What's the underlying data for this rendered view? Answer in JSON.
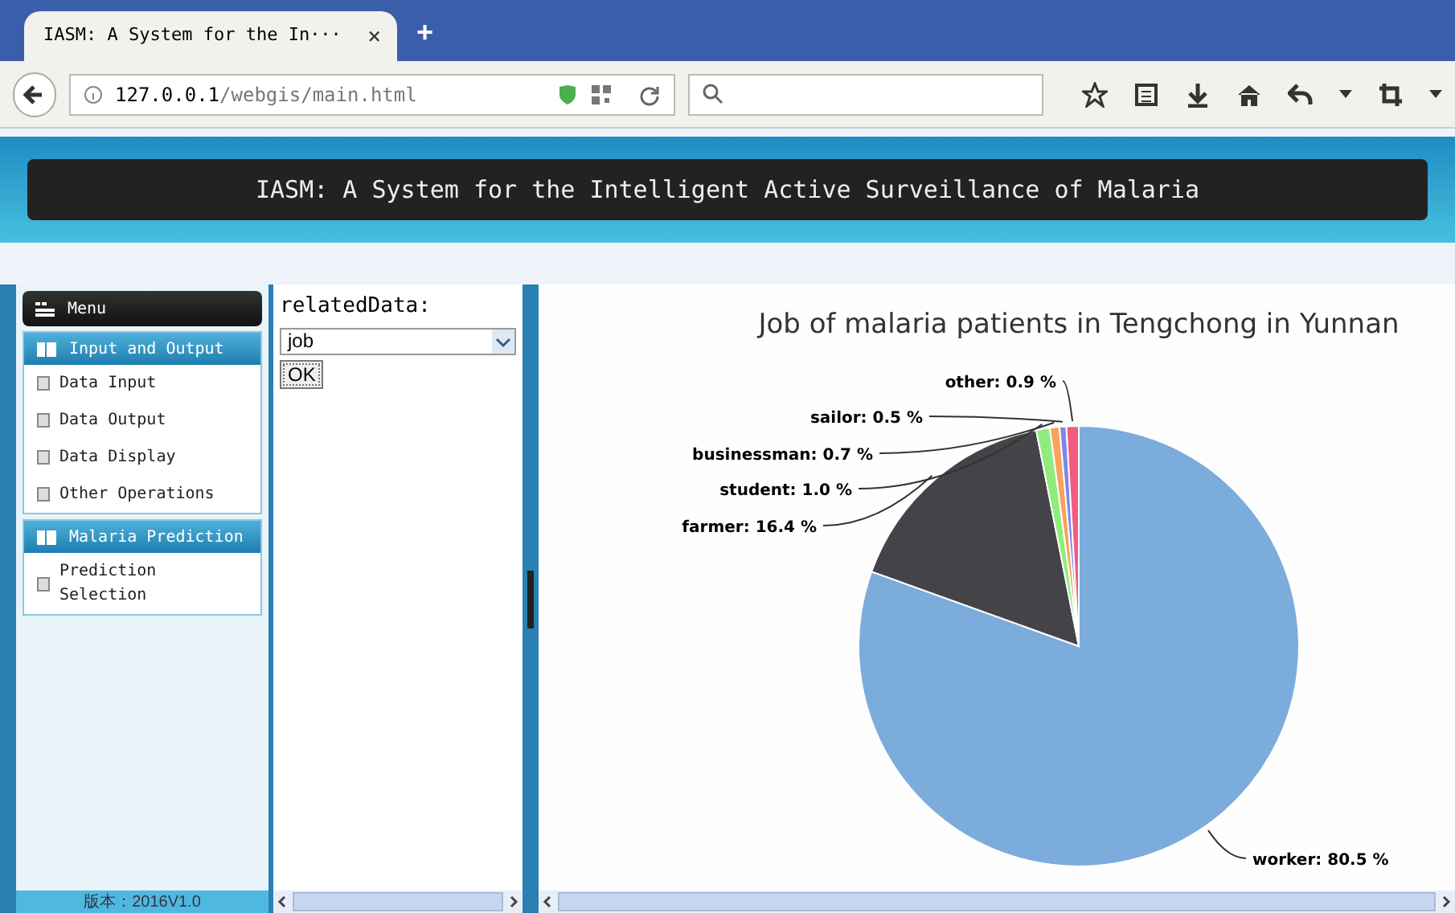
{
  "browser": {
    "tab_title": "IASM: A System for the In···",
    "tab_close": "×",
    "new_tab": "+",
    "url_host": "127.0.0.1",
    "url_path": "/webgis/main.html"
  },
  "banner": {
    "title": "IASM: A System for the Intelligent Active Surveillance of Malaria"
  },
  "sidebar": {
    "title": "Menu",
    "groups": [
      {
        "label": "Input and Output",
        "items": [
          {
            "label": "Data Input"
          },
          {
            "label": "Data Output"
          },
          {
            "label": "Data Display"
          },
          {
            "label": "Other Operations"
          }
        ]
      },
      {
        "label": "Malaria Prediction",
        "items": [
          {
            "label": "Prediction Selection"
          }
        ]
      }
    ],
    "footer": "版本：2016V1.0"
  },
  "form": {
    "label": "relatedData:",
    "select_value": "job",
    "button": "OK"
  },
  "chart": {
    "chart_data": {
      "type": "pie",
      "title": "Job of malaria patients in Tengchong in Yunnan",
      "series": [
        {
          "values": [
            80.5,
            16.4,
            1.0,
            0.7,
            0.5,
            0.9
          ]
        }
      ],
      "colors": [
        "#7cacdc",
        "#434348",
        "#90ed7d",
        "#f7a35c",
        "#8085e9",
        "#f15c80"
      ],
      "value_labels": [
        "worker: 80.5 %",
        "farmer: 16.4 %",
        "student: 1.0 %",
        "businessman: 0.7 %",
        "sailor: 0.5 %",
        "other: 0.9 %"
      ]
    }
  }
}
